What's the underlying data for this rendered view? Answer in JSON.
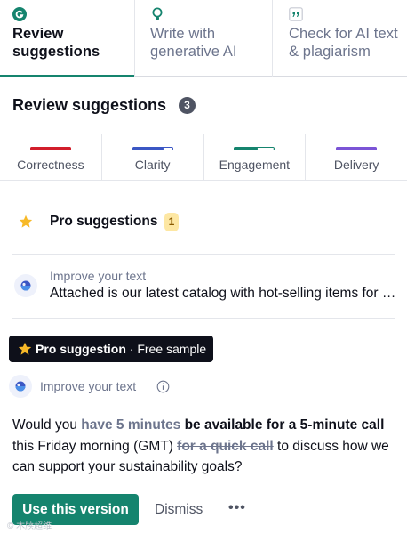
{
  "tabs": [
    {
      "label": "Review suggestions",
      "icon": "grammarly-logo-icon",
      "active": true
    },
    {
      "label": "Write with generative AI",
      "icon": "lightbulb-icon",
      "active": false
    },
    {
      "label": "Check for AI text & plagiarism",
      "icon": "quote-icon",
      "active": false
    }
  ],
  "section": {
    "title": "Review suggestions",
    "count": "3"
  },
  "categories": [
    {
      "label": "Correctness",
      "color": "#d21e2b",
      "fill": 1.0
    },
    {
      "label": "Clarity",
      "color": "#3b57c4",
      "fill": 0.75
    },
    {
      "label": "Engagement",
      "color": "#15846e",
      "fill": 0.55
    },
    {
      "label": "Delivery",
      "color": "#7b54d6",
      "fill": 1.0
    }
  ],
  "pro": {
    "title": "Pro suggestions",
    "count": "1"
  },
  "improve_item": {
    "label": "Improve your text",
    "text": "Attached is our latest catalog with hot-selling items for your reference."
  },
  "card": {
    "pill_strong": "Pro suggestion",
    "pill_rest": " · Free sample",
    "improve_label": "Improve your text",
    "text": {
      "p1": "Would you ",
      "del1": "have 5 minutes",
      "ins1": " be available for a 5-minute call",
      "p2": " this Friday morning (GMT) ",
      "del2": "for a quick call",
      "p3": " to discuss how we can support your sustainability goals?"
    },
    "use_label": "Use this version",
    "dismiss_label": "Dismiss",
    "more_label": "•••"
  },
  "watermark": "© 木牍超维"
}
